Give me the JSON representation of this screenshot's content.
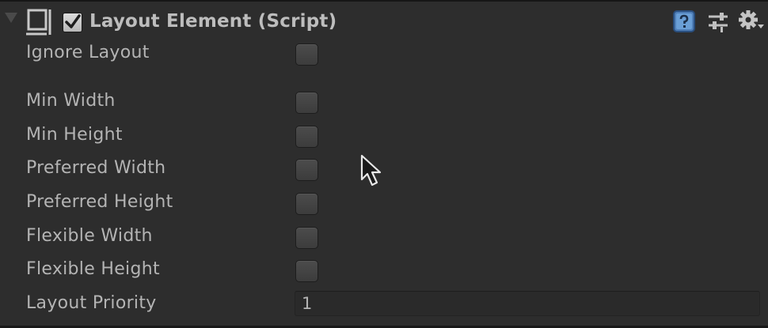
{
  "component": {
    "title": "Layout Element (Script)",
    "enabled": true
  },
  "properties": [
    {
      "label": "Ignore Layout",
      "type": "toggle",
      "value": false
    },
    {
      "label": "Min Width",
      "type": "toggle",
      "value": false
    },
    {
      "label": "Min Height",
      "type": "toggle",
      "value": false
    },
    {
      "label": "Preferred Width",
      "type": "toggle",
      "value": false
    },
    {
      "label": "Preferred Height",
      "type": "toggle",
      "value": false
    },
    {
      "label": "Flexible Width",
      "type": "toggle",
      "value": false
    },
    {
      "label": "Flexible Height",
      "type": "toggle",
      "value": false
    },
    {
      "label": "Layout Priority",
      "type": "int",
      "value": "1"
    }
  ],
  "header_icons": [
    "foldout-arrow-icon",
    "layout-element-icon",
    "help-icon",
    "preset-icon",
    "gear-icon"
  ]
}
